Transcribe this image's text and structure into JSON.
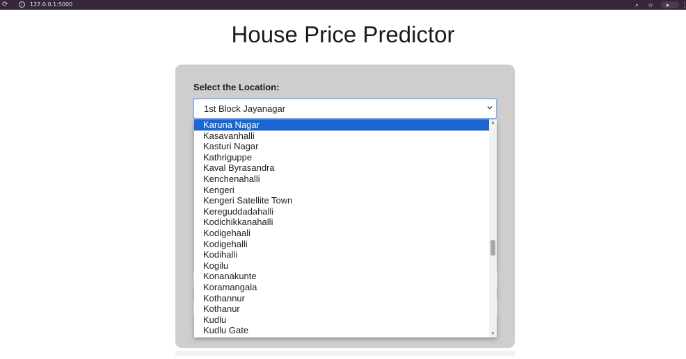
{
  "browser": {
    "url": "127.0.0.1:5000",
    "reload_glyph": "⟳",
    "info_glyph": "i",
    "zoom_glyph": "⌕",
    "star_glyph": "☆",
    "extension_glyph": "▸",
    "menu_glyph": "⋮"
  },
  "page": {
    "title": "House Price Predictor"
  },
  "form": {
    "location_label": "Select the Location:",
    "location_selected": "1st Block Jayanagar",
    "dropdown_options": [
      "Karuna Nagar",
      "Kasavanhalli",
      "Kasturi Nagar",
      "Kathriguppe",
      "Kaval Byrasandra",
      "Kenchenahalli",
      "Kengeri",
      "Kengeri Satellite Town",
      "Kereguddadahalli",
      "Kodichikkanahalli",
      "Kodigehaali",
      "Kodigehalli",
      "Kodihalli",
      "Kogilu",
      "Konanakunte",
      "Koramangala",
      "Kothannur",
      "Kothanur",
      "Kudlu",
      "Kudlu Gate"
    ],
    "highlighted_option": "Karuna Nagar"
  },
  "icons": {
    "chevron": "chevron-down-icon",
    "scroll_up": "scroll-up-arrow-icon",
    "scroll_down": "scroll-down-arrow-icon"
  },
  "colors": {
    "highlight": "#1a66d2",
    "card": "#cfcecd",
    "focus_border": "#8fb4e8",
    "browser_bar": "#35263a"
  }
}
